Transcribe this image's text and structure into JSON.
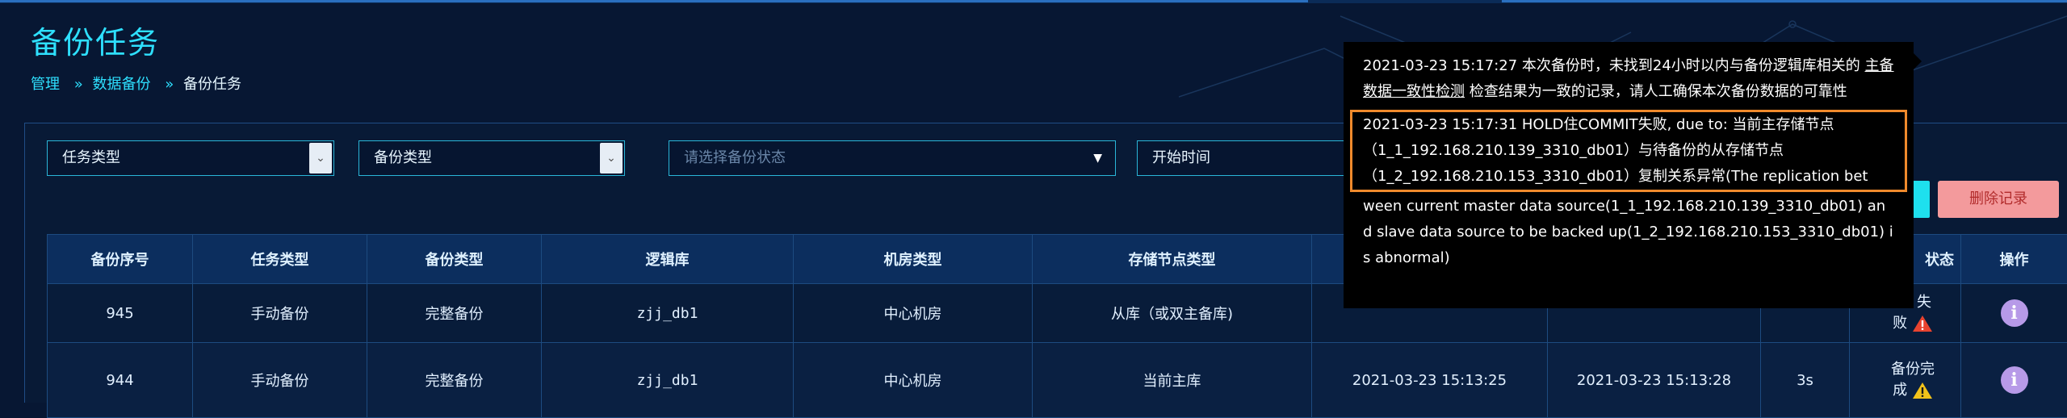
{
  "header": {
    "title": "备份任务",
    "breadcrumb": [
      "管理",
      "数据备份",
      "备份任务"
    ],
    "breadcrumb_sep": "»"
  },
  "filters": {
    "task_type": "任务类型",
    "backup_type": "备份类型",
    "status_placeholder": "请选择备份状态",
    "start_time": "开始时间"
  },
  "toolbar": {
    "delete_label": "删除记录"
  },
  "table": {
    "columns": [
      "备份序号",
      "任务类型",
      "备份类型",
      "逻辑库",
      "机房类型",
      "存储节点类型",
      "",
      "",
      "",
      "状态",
      "操作"
    ],
    "status_header_visible": "状态",
    "rows": [
      {
        "id": "945",
        "task_type": "手动备份",
        "backup_type": "完整备份",
        "logic_db": "zjj_db1",
        "room_type": "中心机房",
        "node_type": "从库（或双主备库)",
        "start": "",
        "end": "",
        "duration": "",
        "status_l1": "失",
        "status_l2": "败"
      },
      {
        "id": "944",
        "task_type": "手动备份",
        "backup_type": "完整备份",
        "logic_db": "zjj_db1",
        "room_type": "中心机房",
        "node_type": "当前主库",
        "start": "2021-03-23 15:13:25",
        "end": "2021-03-23 15:13:28",
        "duration": "3s",
        "status_l1": "备份完",
        "status_l2": "成"
      }
    ]
  },
  "tooltip": {
    "entry1_prefix": "2021-03-23 15:17:27 本次备份时，未找到24小时以内与备份逻辑库相关的",
    "entry1_link": "主备数据一致性检测",
    "entry1_suffix": "检查结果为一致的记录，请人工确保本次备份数据的可靠性",
    "entry2_highlight": "2021-03-23 15:17:31 HOLD住COMMIT失败, due to: 当前主存储节点（1_1_192.168.210.139_3310_db01）与待备份的从存储节点（1_2_192.168.210.153_3310_db01）复制关系异常(The replication bet",
    "entry2_rest": "ween current master data source(1_1_192.168.210.139_3310_db01) and slave data source to be backed up(1_2_192.168.210.153_3310_db01) is abnormal)"
  },
  "colors": {
    "accent": "#2ee0ff",
    "background": "#071733",
    "highlight_border": "#f08a2c",
    "logic_db_text": "#36e06a",
    "delete_button": "#f39a9c"
  },
  "icons": {
    "warning": "warning-triangle-icon",
    "info": "info-circle-icon",
    "dropdown": "chevron-down-icon"
  }
}
